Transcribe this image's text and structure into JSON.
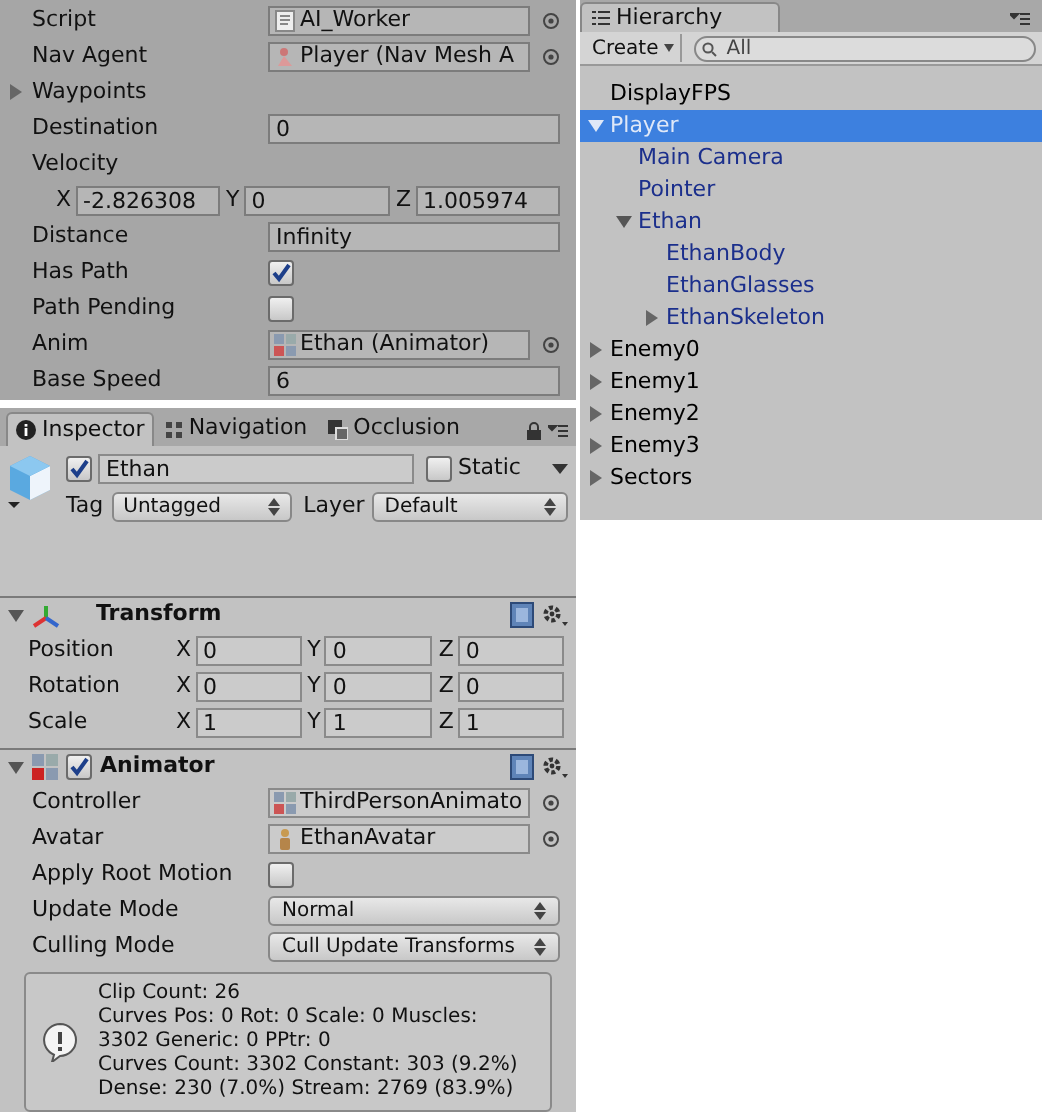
{
  "component": {
    "fields": [
      {
        "kind": "object",
        "label": "Script",
        "value": "AI_Worker"
      },
      {
        "kind": "object",
        "label": "Nav Agent",
        "value": "Player (Nav Mesh A"
      },
      {
        "kind": "foldout",
        "label": "Waypoints",
        "expanded": false
      },
      {
        "kind": "text",
        "label": "Destination",
        "value": "0"
      },
      {
        "kind": "heading",
        "label": "Velocity"
      },
      {
        "kind": "vector",
        "axes": [
          {
            "axis": "X",
            "value": "-2.826308"
          },
          {
            "axis": "Y",
            "value": "0"
          },
          {
            "axis": "Z",
            "value": "1.005974"
          }
        ]
      },
      {
        "kind": "text",
        "label": "Distance",
        "value": "Infinity"
      },
      {
        "kind": "checkbox",
        "label": "Has Path",
        "checked": true
      },
      {
        "kind": "checkbox",
        "label": "Path Pending",
        "checked": false
      },
      {
        "kind": "object",
        "label": "Anim",
        "value": "Ethan (Animator)"
      },
      {
        "kind": "text",
        "label": "Base Speed",
        "value": "6"
      }
    ]
  },
  "hierarchy": {
    "tab": "Hierarchy",
    "create": "Create",
    "search": {
      "placeholder": "All"
    },
    "items": [
      {
        "label": "DisplayFPS",
        "selected": false,
        "prefab": false
      },
      {
        "label": "Player",
        "selected": true,
        "prefab": true,
        "expanded": true,
        "children": [
          {
            "label": "Main Camera",
            "selected": false,
            "prefab": true
          },
          {
            "label": "Pointer",
            "selected": false,
            "prefab": true
          },
          {
            "label": "Ethan",
            "selected": false,
            "prefab": true,
            "expanded": true,
            "children": [
              {
                "label": "EthanBody",
                "selected": false,
                "prefab": true
              },
              {
                "label": "EthanGlasses",
                "selected": false,
                "prefab": true
              },
              {
                "label": "EthanSkeleton",
                "selected": false,
                "prefab": true,
                "expanded": false
              }
            ]
          }
        ]
      },
      {
        "label": "Enemy0",
        "selected": false,
        "prefab": false,
        "expanded": false
      },
      {
        "label": "Enemy1",
        "selected": false,
        "prefab": false,
        "expanded": false
      },
      {
        "label": "Enemy2",
        "selected": false,
        "prefab": false,
        "expanded": false
      },
      {
        "label": "Enemy3",
        "selected": false,
        "prefab": false,
        "expanded": false
      },
      {
        "label": "Sectors",
        "selected": false,
        "prefab": false,
        "expanded": false
      }
    ]
  },
  "inspector": {
    "tabs": [
      {
        "label": "Inspector",
        "selected": true
      },
      {
        "label": "Navigation",
        "selected": false
      },
      {
        "label": "Occlusion",
        "selected": false
      }
    ],
    "object": {
      "active": true,
      "name": "Ethan",
      "static": false,
      "static_label": "Static",
      "tag_label": "Tag",
      "tag": "Untagged",
      "layer_label": "Layer",
      "layer": "Default"
    },
    "transform": {
      "title": "Transform",
      "expanded": true,
      "rows": [
        {
          "label": "Position",
          "axes": [
            {
              "axis": "X",
              "value": "0"
            },
            {
              "axis": "Y",
              "value": "0"
            },
            {
              "axis": "Z",
              "value": "0"
            }
          ]
        },
        {
          "label": "Rotation",
          "axes": [
            {
              "axis": "X",
              "value": "0"
            },
            {
              "axis": "Y",
              "value": "0"
            },
            {
              "axis": "Z",
              "value": "0"
            }
          ]
        },
        {
          "label": "Scale",
          "axes": [
            {
              "axis": "X",
              "value": "1"
            },
            {
              "axis": "Y",
              "value": "1"
            },
            {
              "axis": "Z",
              "value": "1"
            }
          ]
        }
      ]
    },
    "animator": {
      "title": "Animator",
      "expanded": true,
      "enabled": true,
      "fields": [
        {
          "kind": "object",
          "label": "Controller",
          "value": "ThirdPersonAnimato"
        },
        {
          "kind": "object",
          "label": "Avatar",
          "value": "EthanAvatar"
        },
        {
          "kind": "checkbox",
          "label": "Apply Root Motion",
          "checked": false
        },
        {
          "kind": "dropdown",
          "label": "Update Mode",
          "value": "Normal"
        },
        {
          "kind": "dropdown",
          "label": "Culling Mode",
          "value": "Cull Update Transforms"
        }
      ],
      "info": [
        "Clip Count: 26",
        "Curves Pos: 0 Rot: 0 Scale: 0 Muscles:",
        "3302 Generic: 0 PPtr: 0",
        "Curves Count: 3302 Constant: 303 (9.2%)",
        "Dense: 230 (7.0%) Stream: 2769 (83.9%)"
      ]
    }
  }
}
